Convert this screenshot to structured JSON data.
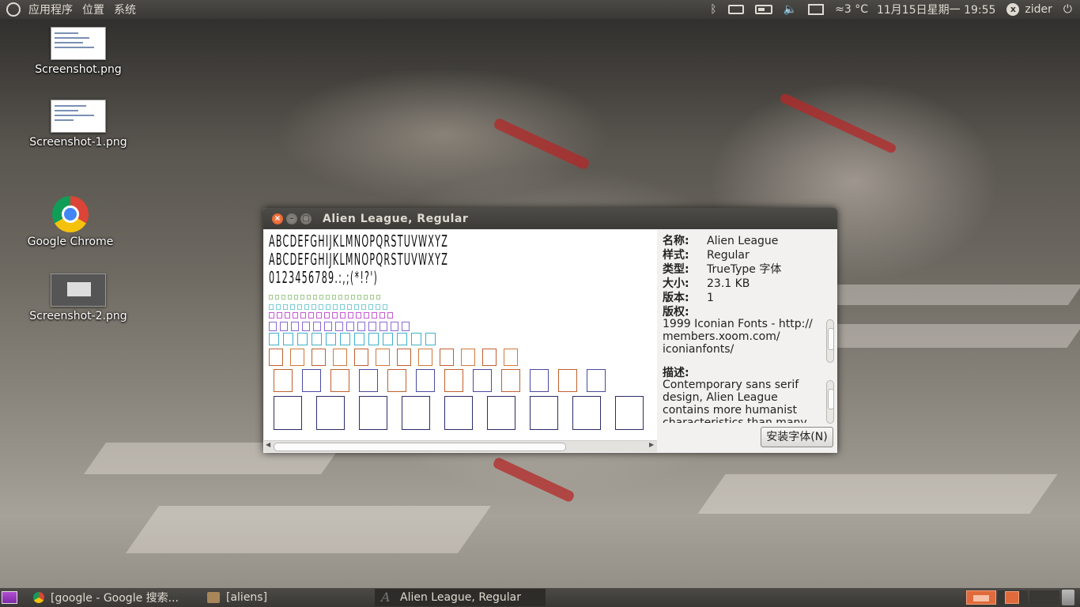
{
  "top_panel": {
    "menus": [
      "应用程序",
      "位置",
      "系统"
    ],
    "weather": "≈3 °C",
    "datetime": "11月15日星期一 19:55",
    "username": "zider",
    "icons": [
      "ubuntu-logo-icon",
      "bluetooth-icon",
      "keyboard-icon",
      "battery-icon",
      "volume-icon",
      "mail-icon",
      "weather-icon",
      "user-status-icon",
      "power-icon"
    ]
  },
  "desktop_icons": [
    {
      "label": "Screenshot.png"
    },
    {
      "label": "Screenshot-1.png"
    },
    {
      "label": "Google Chrome"
    },
    {
      "label": "Screenshot-2.png"
    }
  ],
  "window": {
    "title": "Alien League, Regular",
    "preview": {
      "upper": "ABCDEFGHIJKLMNOPQRSTUVWXYZ",
      "lower": "ABCDEFGHIJKLMNOPQRSTUVWXYZ",
      "digits": "0123456789.:,;(*!?')"
    },
    "info": {
      "name_label": "名称:",
      "name_value": "Alien League",
      "style_label": "样式:",
      "style_value": "Regular",
      "type_label": "类型:",
      "type_value": "TrueType 字体",
      "size_label": "大小:",
      "size_value": "23.1 KB",
      "version_label": "版本:",
      "version_value": "1",
      "copyright_label": "版权:",
      "copyright_value": "1999 Iconian Fonts - http:// members.xoom.com/ iconianfonts/",
      "description_label": "描述:",
      "description_value": "Contemporary sans serif design, Alien League contains more humanist characteristics than many"
    },
    "install_button": "安装字体(N)"
  },
  "taskbar": {
    "tasks": [
      {
        "label": "[google - Google 搜索..."
      },
      {
        "label": "[aliens]"
      },
      {
        "label": "Alien League, Regular"
      }
    ]
  },
  "colors": {
    "panel": "#3c3b37",
    "close_button": "#e2541c",
    "workspace_active": "#e06a3b"
  }
}
